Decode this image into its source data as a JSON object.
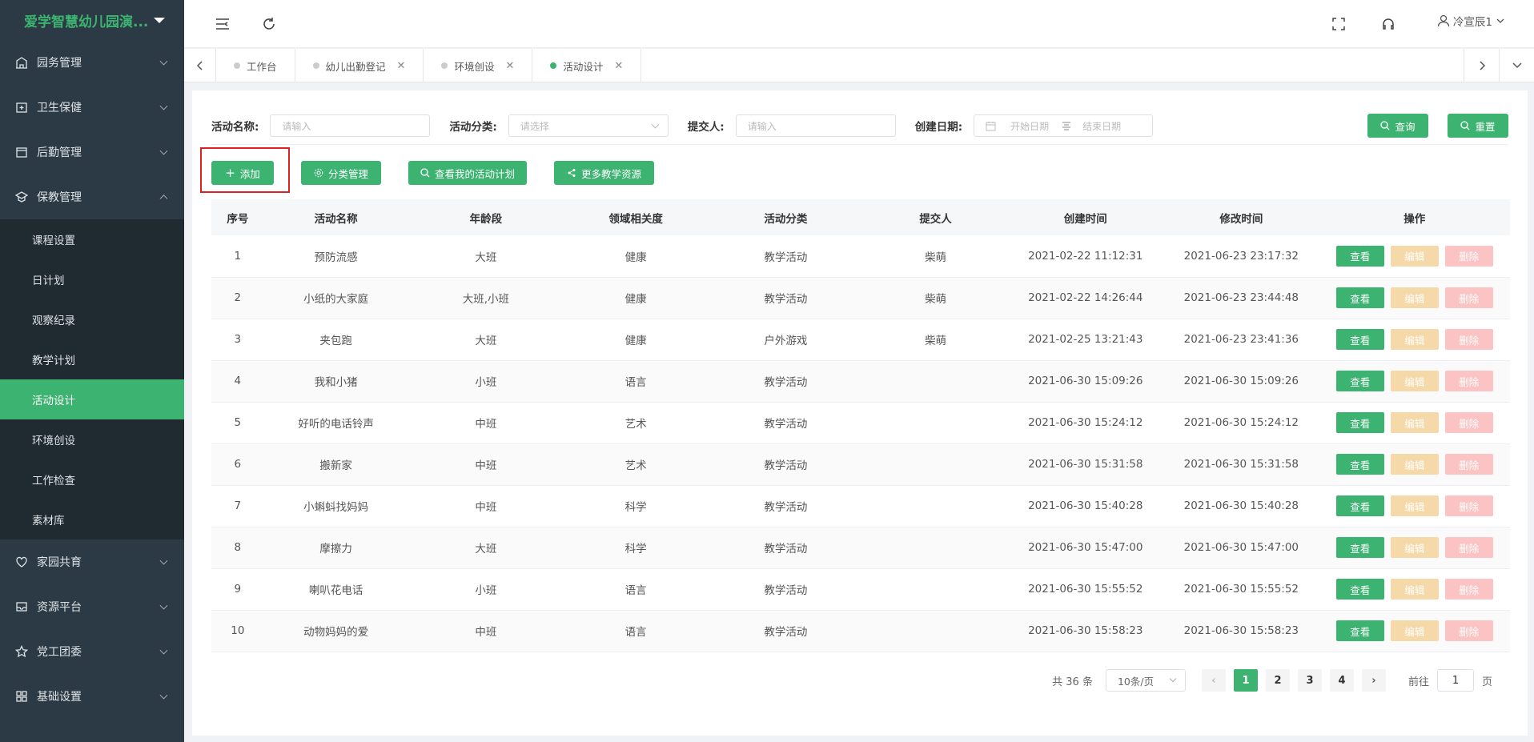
{
  "app": {
    "title": "爱学智慧幼儿园演..."
  },
  "colors": {
    "brand": "#3cb371",
    "sidebar_bg": "#2b3a44",
    "highlight_box": "#e02020"
  },
  "sidebar": {
    "groups": [
      {
        "label": "园务管理",
        "icon": "building-icon"
      },
      {
        "label": "卫生保健",
        "icon": "first-aid-icon"
      },
      {
        "label": "后勤管理",
        "icon": "box-icon"
      },
      {
        "label": "保教管理",
        "icon": "school-icon",
        "expanded": true
      }
    ],
    "sub_items": [
      "课程设置",
      "日计划",
      "观察纪录",
      "教学计划",
      "活动设计",
      "环境创设",
      "工作检查",
      "素材库"
    ],
    "active_sub": "活动设计",
    "groups_after": [
      {
        "label": "家园共育",
        "icon": "heart-icon"
      },
      {
        "label": "资源平台",
        "icon": "inbox-icon"
      },
      {
        "label": "党工团委",
        "icon": "star-icon"
      },
      {
        "label": "基础设置",
        "icon": "grid-icon"
      }
    ]
  },
  "topbar": {
    "user": "冷宣辰1"
  },
  "tabs": [
    {
      "label": "工作台",
      "closable": false,
      "active": false
    },
    {
      "label": "幼儿出勤登记",
      "closable": true,
      "active": false
    },
    {
      "label": "环境创设",
      "closable": true,
      "active": false
    },
    {
      "label": "活动设计",
      "closable": true,
      "active": true
    }
  ],
  "filter": {
    "name_label": "活动名称:",
    "name_placeholder": "请输入",
    "category_label": "活动分类:",
    "category_placeholder": "请选择",
    "submitter_label": "提交人:",
    "submitter_placeholder": "请输入",
    "date_label": "创建日期:",
    "start_placeholder": "开始日期",
    "end_placeholder": "结束日期",
    "query": "查询",
    "reset": "重置"
  },
  "actions": {
    "add": "添加",
    "category_manage": "分类管理",
    "my_plans": "查看我的活动计划",
    "more_resources": "更多教学资源"
  },
  "table": {
    "headers": [
      "序号",
      "活动名称",
      "年龄段",
      "领域相关度",
      "活动分类",
      "提交人",
      "创建时间",
      "修改时间",
      "操作"
    ],
    "op_labels": {
      "view": "查看",
      "edit": "编辑",
      "delete": "删除"
    },
    "rows": [
      [
        "1",
        "预防流感",
        "大班",
        "健康",
        "教学活动",
        "柴萌",
        "2021-02-22 11:12:31",
        "2021-06-23 23:17:32"
      ],
      [
        "2",
        "小纸的大家庭",
        "大班,小班",
        "健康",
        "教学活动",
        "柴萌",
        "2021-02-22 14:26:44",
        "2021-06-23 23:44:48"
      ],
      [
        "3",
        "夹包跑",
        "大班",
        "健康",
        "户外游戏",
        "柴萌",
        "2021-02-25 13:21:43",
        "2021-06-23 23:41:36"
      ],
      [
        "4",
        "我和小猪",
        "小班",
        "语言",
        "教学活动",
        "",
        "2021-06-30 15:09:26",
        "2021-06-30 15:09:26"
      ],
      [
        "5",
        "好听的电话铃声",
        "中班",
        "艺术",
        "教学活动",
        "",
        "2021-06-30 15:24:12",
        "2021-06-30 15:24:12"
      ],
      [
        "6",
        "搬新家",
        "中班",
        "艺术",
        "教学活动",
        "",
        "2021-06-30 15:31:58",
        "2021-06-30 15:31:58"
      ],
      [
        "7",
        "小蝌蚪找妈妈",
        "中班",
        "科学",
        "教学活动",
        "",
        "2021-06-30 15:40:28",
        "2021-06-30 15:40:28"
      ],
      [
        "8",
        "摩擦力",
        "大班",
        "科学",
        "教学活动",
        "",
        "2021-06-30 15:47:00",
        "2021-06-30 15:47:00"
      ],
      [
        "9",
        "喇叭花电话",
        "小班",
        "语言",
        "教学活动",
        "",
        "2021-06-30 15:55:52",
        "2021-06-30 15:55:52"
      ],
      [
        "10",
        "动物妈妈的爱",
        "中班",
        "语言",
        "教学活动",
        "",
        "2021-06-30 15:58:23",
        "2021-06-30 15:58:23"
      ]
    ]
  },
  "pagination": {
    "total": "共 36 条",
    "page_size": "10条/页",
    "pages": [
      "1",
      "2",
      "3",
      "4"
    ],
    "current": "1",
    "goto_label": "前往",
    "goto_value": "1",
    "page_suffix": "页"
  }
}
